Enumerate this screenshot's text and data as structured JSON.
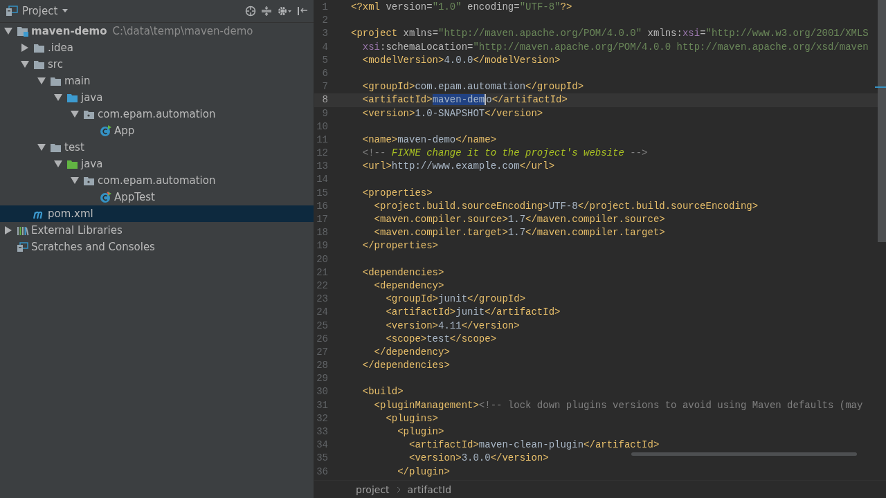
{
  "project_panel": {
    "title": "Project",
    "tree": [
      {
        "label": "maven-demo",
        "path": "C:\\data\\temp\\maven-demo",
        "kind": "module",
        "expanded": true,
        "selected": false,
        "children": [
          {
            "label": ".idea",
            "kind": "folder",
            "expanded": false,
            "selected": false
          },
          {
            "label": "src",
            "kind": "folder",
            "expanded": true,
            "selected": false,
            "children": [
              {
                "label": "main",
                "kind": "folder",
                "expanded": true,
                "selected": false,
                "children": [
                  {
                    "label": "java",
                    "kind": "source-folder",
                    "expanded": true,
                    "selected": false,
                    "children": [
                      {
                        "label": "com.epam.automation",
                        "kind": "package",
                        "expanded": true,
                        "selected": false,
                        "children": [
                          {
                            "label": "App",
                            "kind": "class",
                            "selected": false
                          }
                        ]
                      }
                    ]
                  }
                ]
              },
              {
                "label": "test",
                "kind": "folder",
                "expanded": true,
                "selected": false,
                "children": [
                  {
                    "label": "java",
                    "kind": "test-folder",
                    "expanded": true,
                    "selected": false,
                    "children": [
                      {
                        "label": "com.epam.automation",
                        "kind": "package",
                        "expanded": true,
                        "selected": false,
                        "children": [
                          {
                            "label": "AppTest",
                            "kind": "test-class",
                            "selected": false
                          }
                        ]
                      }
                    ]
                  }
                ]
              }
            ]
          },
          {
            "label": "pom.xml",
            "kind": "maven",
            "selected": true
          }
        ]
      },
      {
        "label": "External Libraries",
        "kind": "libraries",
        "expanded": false,
        "selected": false
      },
      {
        "label": "Scratches and Consoles",
        "kind": "scratches",
        "selected": false
      }
    ]
  },
  "editor": {
    "lines": [
      {
        "number": "1",
        "tokens": [
          {
            "kind": "tag",
            "text": "<?xml"
          },
          {
            "kind": "attr",
            "text": " version="
          },
          {
            "kind": "string",
            "text": "\"1.0\""
          },
          {
            "kind": "attr",
            "text": " encoding="
          },
          {
            "kind": "string",
            "text": "\"UTF-8\""
          },
          {
            "kind": "tag",
            "text": "?>"
          }
        ]
      },
      {
        "number": "2"
      },
      {
        "number": "3",
        "tokens": [
          {
            "kind": "tag",
            "text": "<project"
          },
          {
            "kind": "attr",
            "text": " xmlns="
          },
          {
            "kind": "string",
            "text": "\"http://maven.apache.org/POM/4.0.0\""
          },
          {
            "kind": "attr",
            "text": " xmlns:"
          },
          {
            "kind": "namespace",
            "text": "xsi"
          },
          {
            "kind": "attr",
            "text": "="
          },
          {
            "kind": "string",
            "text": "\"http://www.w3.org/2001/XMLS"
          }
        ]
      },
      {
        "number": "4",
        "tokens": [
          {
            "kind": "namespace",
            "text": "  xsi"
          },
          {
            "kind": "attr",
            "text": ":schemaLocation="
          },
          {
            "kind": "string",
            "text": "\"http://maven.apache.org/POM/4.0.0 http://maven.apache.org/xsd/maven"
          }
        ]
      },
      {
        "number": "5",
        "tokens": [
          {
            "kind": "tag",
            "text": "  <modelVersion>"
          },
          {
            "kind": "text",
            "text": "4.0.0"
          },
          {
            "kind": "tag",
            "text": "</modelVersion>"
          }
        ]
      },
      {
        "number": "6"
      },
      {
        "number": "7",
        "tokens": [
          {
            "kind": "tag",
            "text": "  <groupId>"
          },
          {
            "kind": "text",
            "text": "com.epam.automation"
          },
          {
            "kind": "tag",
            "text": "</groupId>"
          }
        ]
      },
      {
        "number": "8",
        "current": true,
        "tokens": [
          {
            "kind": "tag",
            "text": "  <artifactId>"
          },
          {
            "kind": "selection",
            "text": "maven-dem"
          },
          {
            "kind": "text",
            "text": "o"
          },
          {
            "kind": "tag",
            "text": "</artifactId>"
          }
        ]
      },
      {
        "number": "9",
        "tokens": [
          {
            "kind": "tag",
            "text": "  <version>"
          },
          {
            "kind": "text",
            "text": "1.0-SNAPSHOT"
          },
          {
            "kind": "tag",
            "text": "</version>"
          }
        ]
      },
      {
        "number": "10"
      },
      {
        "number": "11",
        "tokens": [
          {
            "kind": "tag",
            "text": "  <name>"
          },
          {
            "kind": "text",
            "text": "maven-demo"
          },
          {
            "kind": "tag",
            "text": "</name>"
          }
        ]
      },
      {
        "number": "12",
        "tokens": [
          {
            "kind": "comment",
            "text": "  <!-- "
          },
          {
            "kind": "todo",
            "text": "FIXME change it to the project's website"
          },
          {
            "kind": "comment",
            "text": " -->"
          }
        ]
      },
      {
        "number": "13",
        "tokens": [
          {
            "kind": "tag",
            "text": "  <url>"
          },
          {
            "kind": "text",
            "text": "http://www.example.com"
          },
          {
            "kind": "tag",
            "text": "</url>"
          }
        ]
      },
      {
        "number": "14"
      },
      {
        "number": "15",
        "tokens": [
          {
            "kind": "tag",
            "text": "  <properties>"
          }
        ]
      },
      {
        "number": "16",
        "tokens": [
          {
            "kind": "tag",
            "text": "    <project.build.sourceEncoding>"
          },
          {
            "kind": "text",
            "text": "UTF-8"
          },
          {
            "kind": "tag",
            "text": "</project.build.sourceEncoding>"
          }
        ]
      },
      {
        "number": "17",
        "tokens": [
          {
            "kind": "tag",
            "text": "    <maven.compiler.source>"
          },
          {
            "kind": "text",
            "text": "1.7"
          },
          {
            "kind": "tag",
            "text": "</maven.compiler.source>"
          }
        ]
      },
      {
        "number": "18",
        "tokens": [
          {
            "kind": "tag",
            "text": "    <maven.compiler.target>"
          },
          {
            "kind": "text",
            "text": "1.7"
          },
          {
            "kind": "tag",
            "text": "</maven.compiler.target>"
          }
        ]
      },
      {
        "number": "19",
        "tokens": [
          {
            "kind": "tag",
            "text": "  </properties>"
          }
        ]
      },
      {
        "number": "20"
      },
      {
        "number": "21",
        "tokens": [
          {
            "kind": "tag",
            "text": "  <dependencies>"
          }
        ]
      },
      {
        "number": "22",
        "tokens": [
          {
            "kind": "tag",
            "text": "    <dependency>"
          }
        ]
      },
      {
        "number": "23",
        "tokens": [
          {
            "kind": "tag",
            "text": "      <groupId>"
          },
          {
            "kind": "text",
            "text": "junit"
          },
          {
            "kind": "tag",
            "text": "</groupId>"
          }
        ]
      },
      {
        "number": "24",
        "tokens": [
          {
            "kind": "tag",
            "text": "      <artifactId>"
          },
          {
            "kind": "text",
            "text": "junit"
          },
          {
            "kind": "tag",
            "text": "</artifactId>"
          }
        ]
      },
      {
        "number": "25",
        "tokens": [
          {
            "kind": "tag",
            "text": "      <version>"
          },
          {
            "kind": "text",
            "text": "4.11"
          },
          {
            "kind": "tag",
            "text": "</version>"
          }
        ]
      },
      {
        "number": "26",
        "tokens": [
          {
            "kind": "tag",
            "text": "      <scope>"
          },
          {
            "kind": "text",
            "text": "test"
          },
          {
            "kind": "tag",
            "text": "</scope>"
          }
        ]
      },
      {
        "number": "27",
        "tokens": [
          {
            "kind": "tag",
            "text": "    </dependency>"
          }
        ]
      },
      {
        "number": "28",
        "tokens": [
          {
            "kind": "tag",
            "text": "  </dependencies>"
          }
        ]
      },
      {
        "number": "29"
      },
      {
        "number": "30",
        "tokens": [
          {
            "kind": "tag",
            "text": "  <build>"
          }
        ]
      },
      {
        "number": "31",
        "tokens": [
          {
            "kind": "tag",
            "text": "    <pluginManagement>"
          },
          {
            "kind": "comment",
            "text": "<!-- lock down plugins versions to avoid using Maven defaults (may"
          }
        ]
      },
      {
        "number": "32",
        "tokens": [
          {
            "kind": "tag",
            "text": "      <plugins>"
          }
        ]
      },
      {
        "number": "33",
        "tokens": [
          {
            "kind": "tag",
            "text": "        <plugin>"
          }
        ]
      },
      {
        "number": "34",
        "tokens": [
          {
            "kind": "tag",
            "text": "          <artifactId>"
          },
          {
            "kind": "text",
            "text": "maven-clean-plugin"
          },
          {
            "kind": "tag",
            "text": "</artifactId>"
          }
        ]
      },
      {
        "number": "35",
        "tokens": [
          {
            "kind": "tag",
            "text": "          <version>"
          },
          {
            "kind": "text",
            "text": "3.0.0"
          },
          {
            "kind": "tag",
            "text": "</version>"
          }
        ]
      },
      {
        "number": "36",
        "tokens": [
          {
            "kind": "tag",
            "text": "        </plugin>"
          }
        ]
      }
    ],
    "breadcrumbs": [
      "project",
      "artifactId"
    ]
  }
}
